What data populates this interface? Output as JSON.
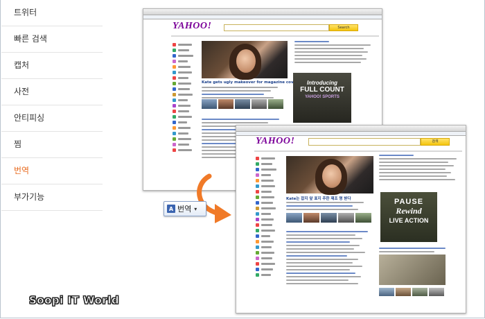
{
  "sidebar": {
    "items": [
      {
        "label": "트위터"
      },
      {
        "label": "빠른 검색"
      },
      {
        "label": "캡처"
      },
      {
        "label": "사전"
      },
      {
        "label": "안티피싱"
      },
      {
        "label": "찜"
      },
      {
        "label": "번역",
        "active": true
      },
      {
        "label": "부가기능"
      }
    ]
  },
  "shot_original": {
    "logo": "YAHOO!",
    "search_button": "Search",
    "headline": "Kate gets ugly makeover for magazine cover",
    "ad_line1": "Introducing",
    "ad_line2": "FULL COUNT",
    "ad_line3": "YAHOO! SPORTS"
  },
  "shot_translated": {
    "logo": "YAHOO!",
    "search_button": "검색",
    "headline": "Kate는 잡지 앞 표지 추한 재조 명 받다",
    "ad_line1": "PAUSE",
    "ad_line2": "Rewind",
    "ad_line3": "LIVE ACTION"
  },
  "translate_button": {
    "label": "번역",
    "icon": "translate-icon",
    "dropdown": "▾"
  },
  "watermark": "Soopi IT World",
  "colors": {
    "active": "#e8691c",
    "yahoo_purple": "#7b0099",
    "arrow": "#f07a28",
    "button_border": "#8aa2c8"
  }
}
